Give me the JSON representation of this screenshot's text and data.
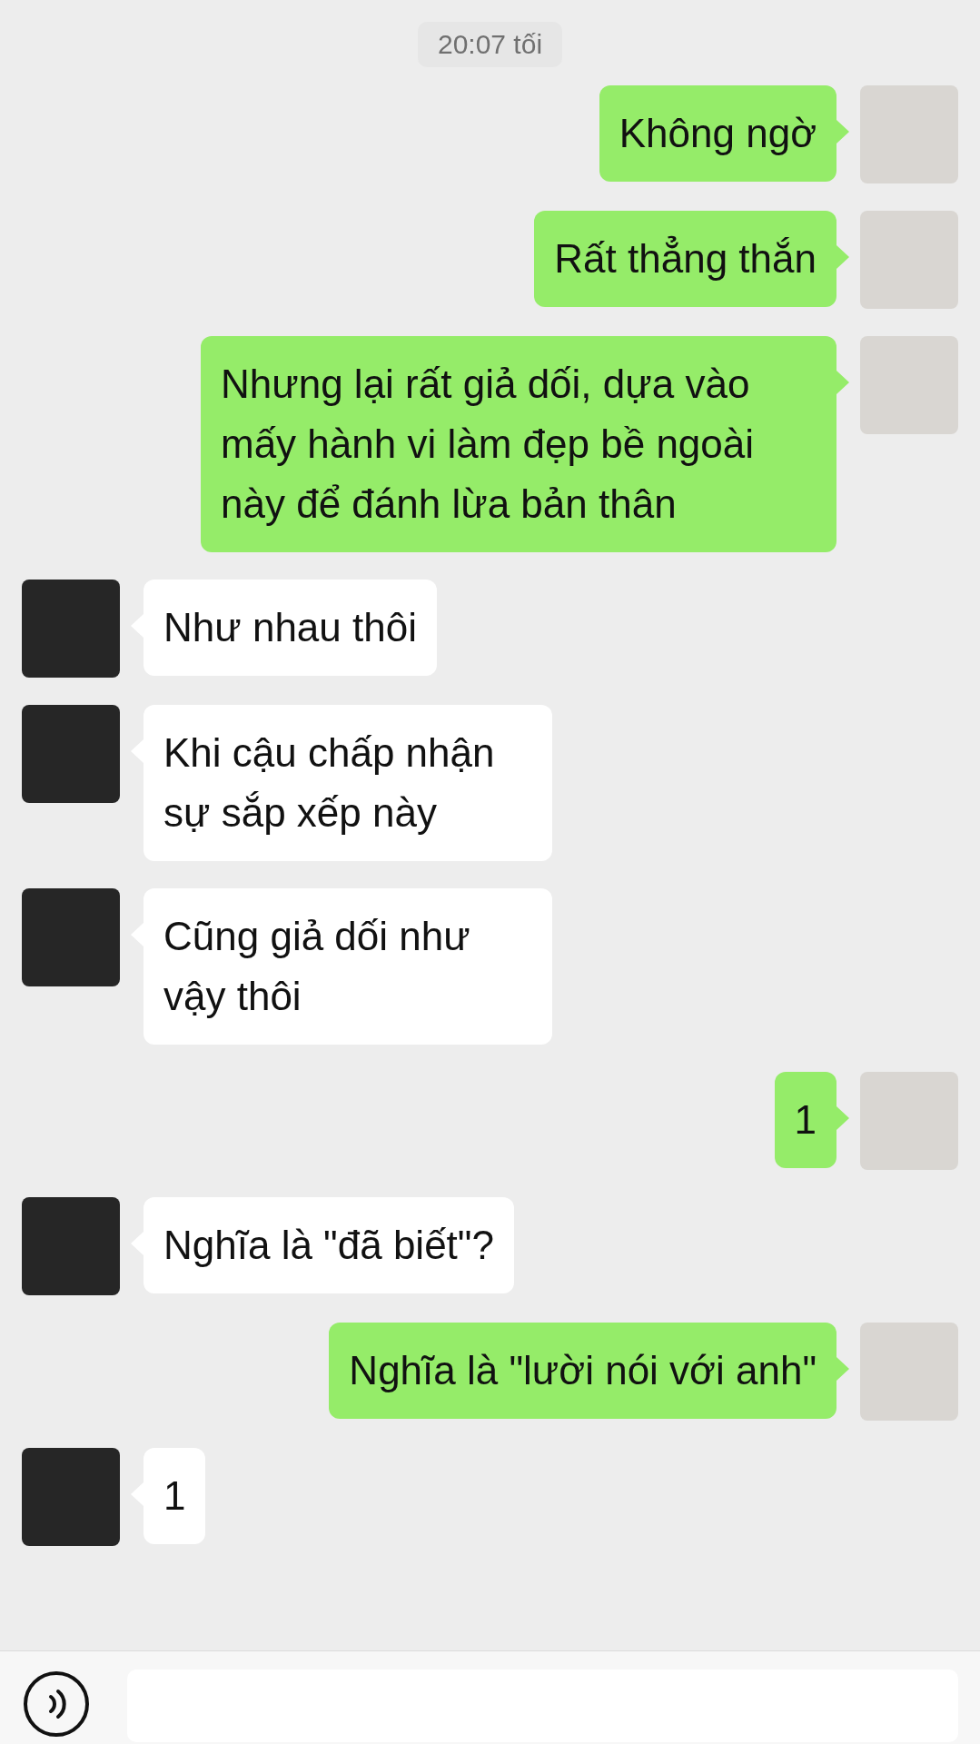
{
  "timestamp": "20:07 tối",
  "messages": [
    {
      "kind": "sent",
      "text": "Không ngờ"
    },
    {
      "kind": "sent",
      "text": "Rất thẳng thắn"
    },
    {
      "kind": "sent",
      "text": "Nhưng lại rất giả dối, dựa vào mấy hành vi làm đẹp bề ngoài này để đánh lừa bản thân"
    },
    {
      "kind": "received",
      "text": "Như nhau thôi"
    },
    {
      "kind": "received",
      "text": "Khi cậu chấp nhận sự sắp xếp này"
    },
    {
      "kind": "received",
      "text": "Cũng giả dối như vậy thôi"
    },
    {
      "kind": "sent",
      "text": "1"
    },
    {
      "kind": "received",
      "text": "Nghĩa là \"đã biết\"?"
    },
    {
      "kind": "sent",
      "text": "Nghĩa là \"lười nói với anh\""
    },
    {
      "kind": "received",
      "text": "1"
    }
  ]
}
